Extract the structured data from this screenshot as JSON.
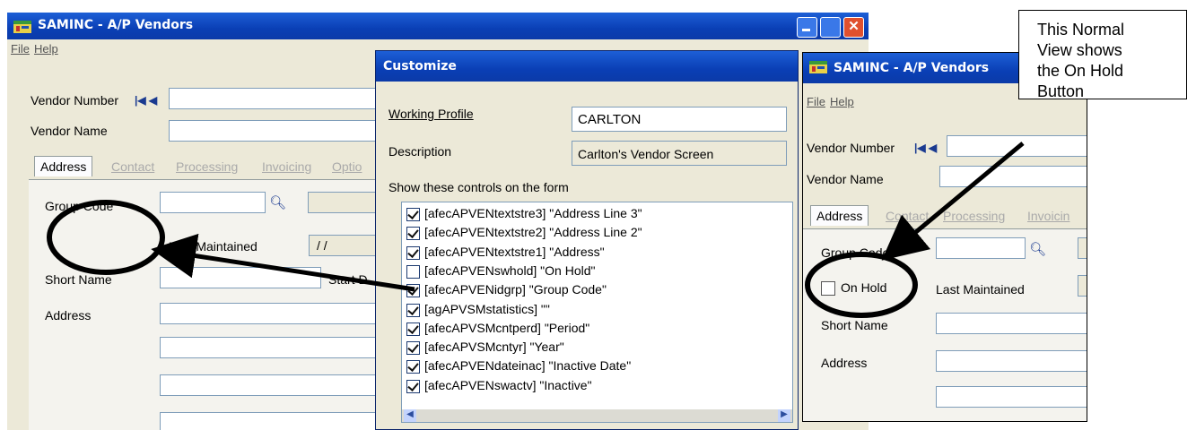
{
  "back_window": {
    "title": "SAMINC - A/P Vendors",
    "menu": [
      "File",
      "Help"
    ],
    "vendor_number_label": "Vendor Number",
    "vendor_name_label": "Vendor Name",
    "tabs": [
      "Address",
      "Contact",
      "Processing",
      "Invoicing",
      "Optio"
    ],
    "group_code_label": "Group Code",
    "last_maintained_label": "Last Maintained",
    "last_maintained_value": "/ /",
    "short_name_label": "Short Name",
    "start_label": "Start D",
    "address_label": "Address"
  },
  "customize_dialog": {
    "title": "Customize",
    "working_profile_label": "Working Profile",
    "working_profile_value": "CARLTON",
    "description_label": "Description",
    "description_value": "Carlton's Vendor Screen",
    "show_controls_label": "Show these controls on the form",
    "controls": [
      {
        "text": "[afecAPVENtextstre3]    \"Address Line 3\"",
        "checked": true
      },
      {
        "text": "[afecAPVENtextstre2]    \"Address Line 2\"",
        "checked": true
      },
      {
        "text": "[afecAPVENtextstre1]    \"Address\"",
        "checked": true
      },
      {
        "text": "[afecAPVENswhold]    \"On Hold\"",
        "checked": false
      },
      {
        "text": "[afecAPVENidgrp]    \"Group Code\"",
        "checked": true
      },
      {
        "text": "[agAPVSMstatistics]    \"\"",
        "checked": true
      },
      {
        "text": "[afecAPVSMcntperd]    \"Period\"",
        "checked": true
      },
      {
        "text": "[afecAPVSMcntyr]    \"Year\"",
        "checked": true
      },
      {
        "text": "[afecAPVENdateinac]    \"Inactive Date\"",
        "checked": true
      },
      {
        "text": "[afecAPVENswactv]    \"Inactive\"",
        "checked": true
      }
    ]
  },
  "front_window": {
    "title": "SAMINC - A/P Vendors",
    "menu": [
      "File",
      "Help"
    ],
    "vendor_number_label": "Vendor Number",
    "vendor_name_label": "Vendor Name",
    "tabs": [
      "Address",
      "Contact",
      "Processing",
      "Invoicin"
    ],
    "group_code_label": "Group Code",
    "on_hold_label": "On Hold",
    "last_maintained_label": "Last Maintained",
    "short_name_label": "Short Name",
    "address_label": "Address"
  },
  "callout": {
    "lines": [
      "This Normal",
      "View shows",
      "the On Hold",
      "Button"
    ]
  },
  "colors": {
    "titlebar": "#0a3fb5",
    "window_bg": "#ece9d8",
    "annotation": "#000000"
  }
}
